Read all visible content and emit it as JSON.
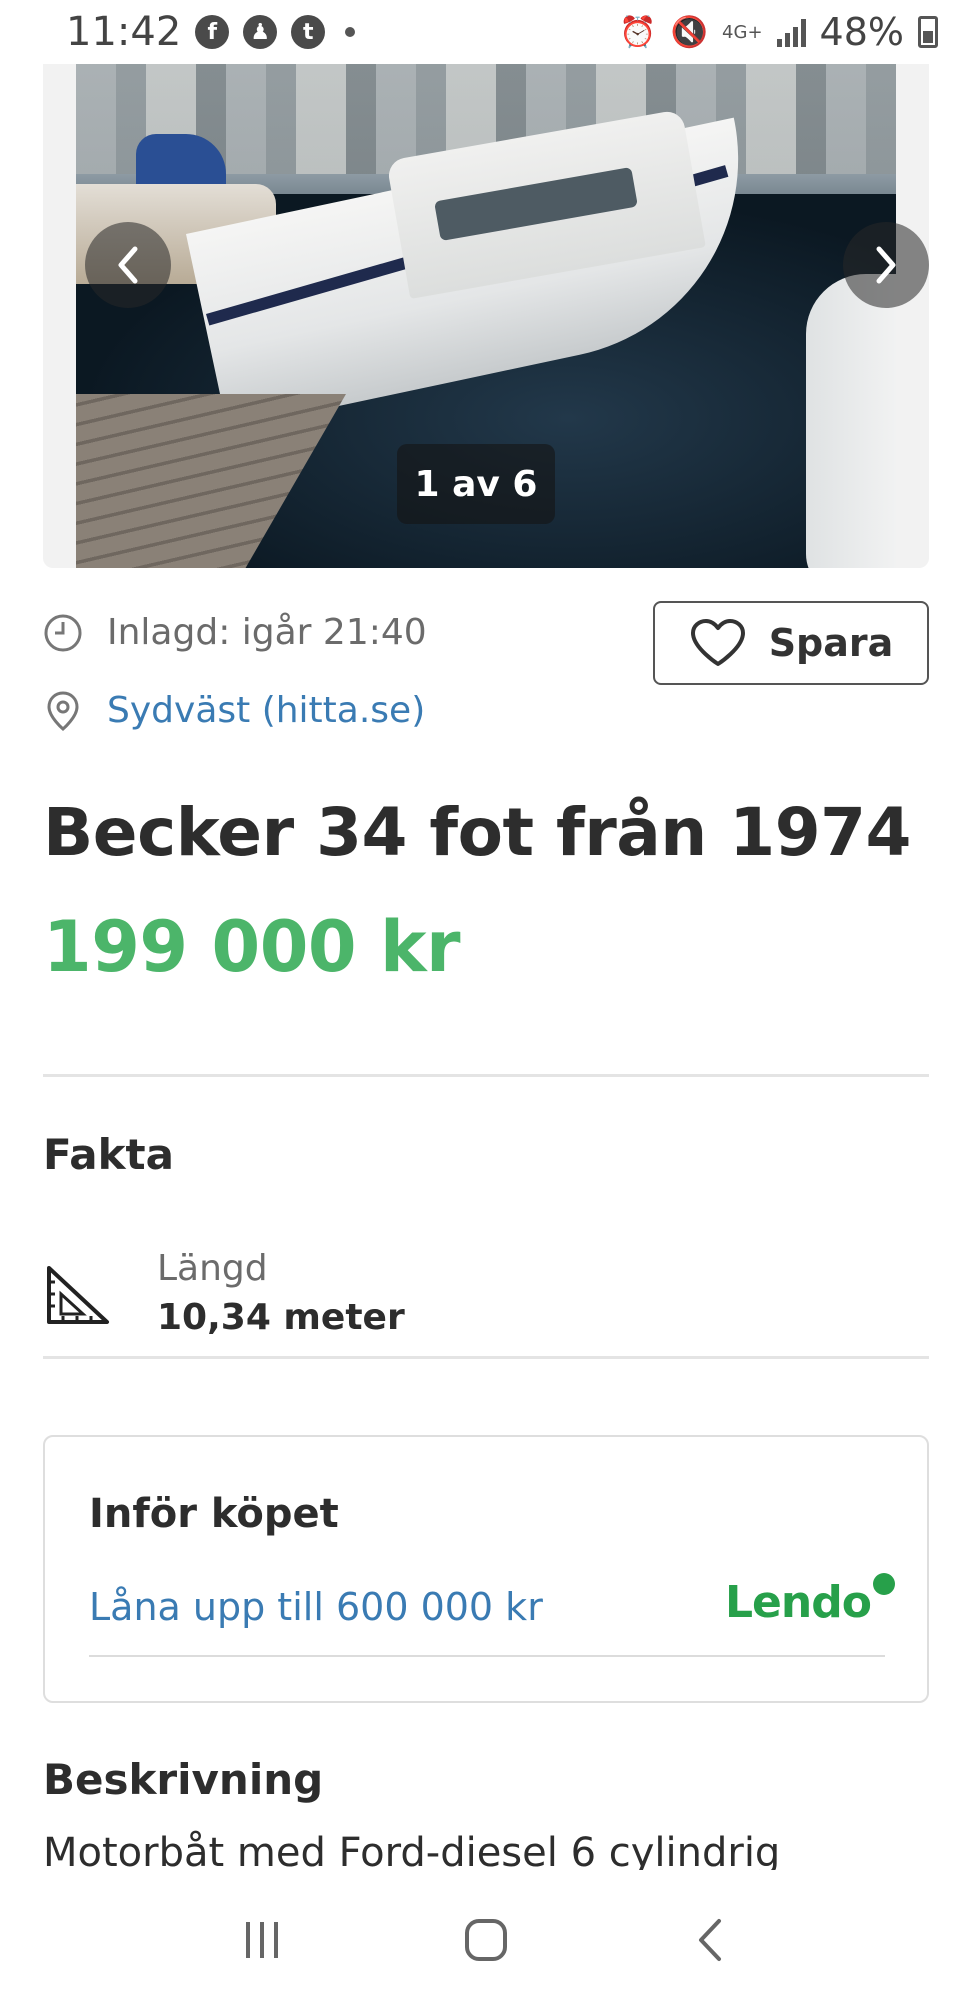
{
  "status_bar": {
    "time": "11:42",
    "battery": "48%",
    "network": "4G+"
  },
  "gallery": {
    "counter": "1 av 6",
    "prev_label": "‹",
    "next_label": "›"
  },
  "listing": {
    "posted": "Inlagd: igår 21:40",
    "location": "Sydväst (hitta.se)",
    "save_label": "Spara",
    "title": "Becker 34 fot från 1974",
    "price": "199 000 kr",
    "price_color": "#4cb56a"
  },
  "facts": {
    "heading": "Fakta",
    "items": [
      {
        "label": "Längd",
        "value": "10,34 meter",
        "icon": "set-square-icon"
      }
    ]
  },
  "loan": {
    "heading": "Inför köpet",
    "link": "Låna upp till 600 000 kr",
    "brand": "Lendo",
    "brand_color": "#27a04a"
  },
  "description": {
    "heading": "Beskrivning",
    "text": "Motorbåt med Ford-diesel 6 cylindrig"
  },
  "colors": {
    "link": "#3a7bb3",
    "text": "#2d2d2d"
  }
}
